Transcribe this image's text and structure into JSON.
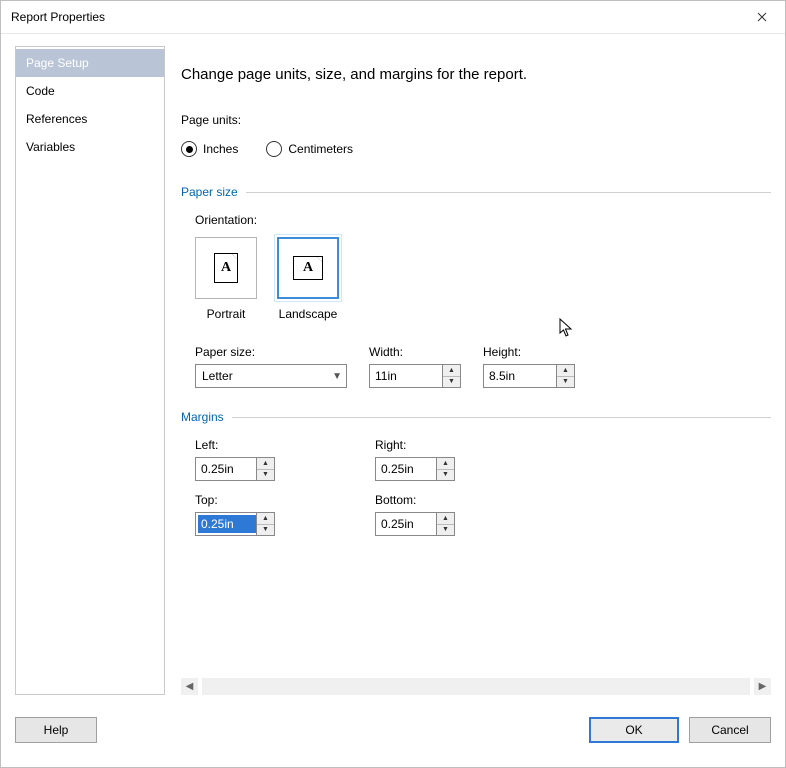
{
  "window": {
    "title": "Report Properties"
  },
  "sidebar": {
    "items": [
      {
        "label": "Page Setup",
        "selected": true
      },
      {
        "label": "Code",
        "selected": false
      },
      {
        "label": "References",
        "selected": false
      },
      {
        "label": "Variables",
        "selected": false
      }
    ]
  },
  "page": {
    "heading": "Change page units, size, and margins for the report.",
    "units": {
      "label": "Page units:",
      "inches": "Inches",
      "centimeters": "Centimeters",
      "selected": "inches"
    },
    "paperSize": {
      "group": "Paper size",
      "orientationLabel": "Orientation:",
      "portrait": "Portrait",
      "landscape": "Landscape",
      "selected": "landscape",
      "paperSizeLabel": "Paper size:",
      "paperSizeValue": "Letter",
      "widthLabel": "Width:",
      "widthValue": "11in",
      "heightLabel": "Height:",
      "heightValue": "8.5in"
    },
    "margins": {
      "group": "Margins",
      "leftLabel": "Left:",
      "leftValue": "0.25in",
      "rightLabel": "Right:",
      "rightValue": "0.25in",
      "topLabel": "Top:",
      "topValue": "0.25in",
      "bottomLabel": "Bottom:",
      "bottomValue": "0.25in"
    }
  },
  "buttons": {
    "help": "Help",
    "ok": "OK",
    "cancel": "Cancel"
  }
}
